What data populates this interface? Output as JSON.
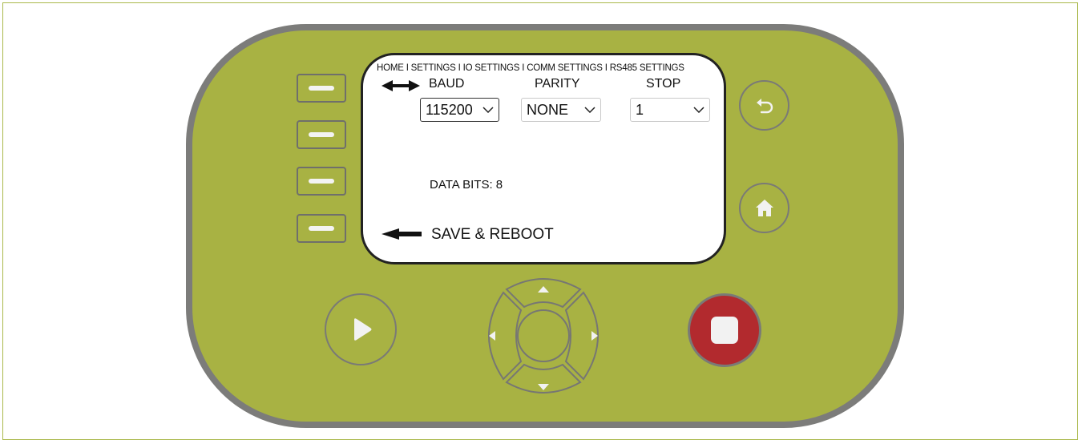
{
  "screen": {
    "breadcrumb": "HOME I SETTINGS I IO SETTINGS I COMM SETTINGS I RS485 SETTINGS",
    "fields": {
      "baud": {
        "label": "BAUD",
        "value": "115200"
      },
      "parity": {
        "label": "PARITY",
        "value": "NONE"
      },
      "stop": {
        "label": "STOP",
        "value": "1"
      }
    },
    "data_bits": "DATA BITS: 8",
    "save_label": "SAVE & REBOOT"
  },
  "colors": {
    "device_body": "#a8b243",
    "device_border": "#7c7c7a",
    "stop_button": "#b22a2e"
  },
  "icons": {
    "back": "back-arrow-icon",
    "home": "home-icon",
    "play": "play-icon",
    "stop": "stop-square-icon"
  }
}
